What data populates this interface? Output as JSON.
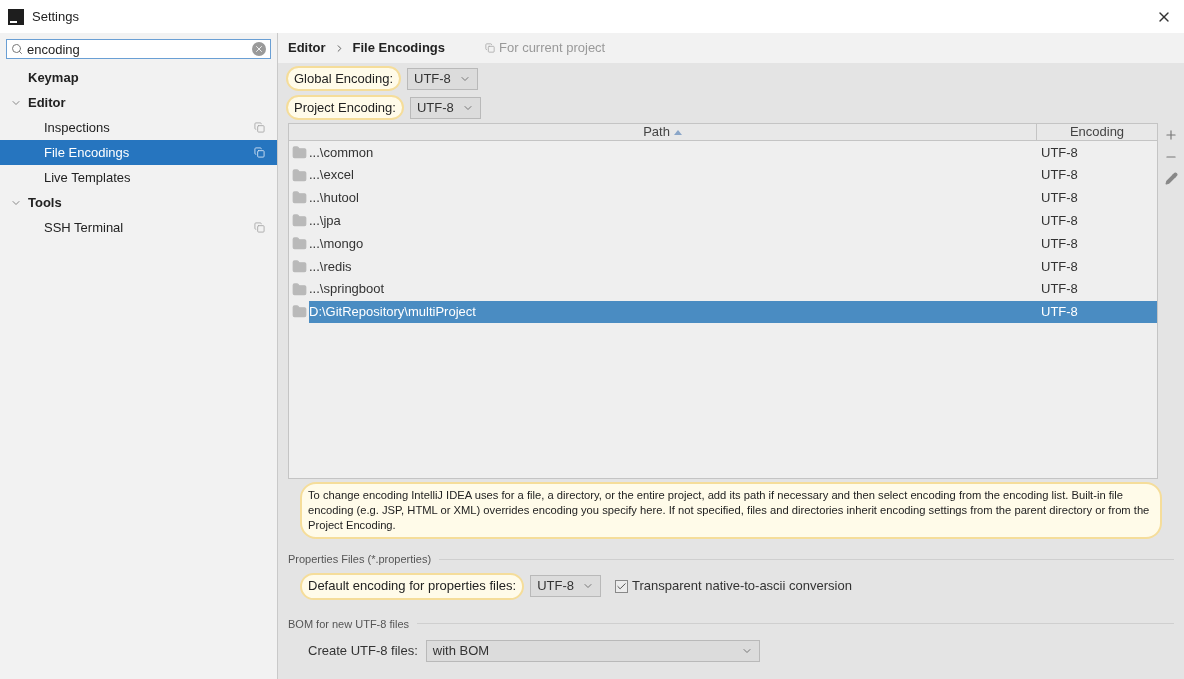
{
  "window": {
    "title": "Settings"
  },
  "search": {
    "value": "encoding"
  },
  "sidebar": {
    "items": [
      {
        "label": "Keymap",
        "selected": false
      },
      {
        "label": "Editor",
        "selected": false,
        "expanded": true,
        "children": [
          {
            "label": "Inspections",
            "selected": false,
            "project_scope": true
          },
          {
            "label": "File Encodings",
            "selected": true,
            "project_scope": true
          },
          {
            "label": "Live Templates",
            "selected": false,
            "project_scope": false
          }
        ]
      },
      {
        "label": "Tools",
        "selected": false,
        "expanded": true,
        "children": [
          {
            "label": "SSH Terminal",
            "selected": false,
            "project_scope": true
          }
        ]
      }
    ]
  },
  "breadcrumb": [
    "Editor",
    "File Encodings"
  ],
  "scope_note": "For current project",
  "encodings": [
    {
      "label": "Global Encoding:",
      "highlighted": true,
      "value": "UTF-8"
    },
    {
      "label": "Project Encoding:",
      "highlighted": true,
      "value": "UTF-8"
    }
  ],
  "table": {
    "columns": [
      {
        "label": "Path",
        "sorted": true
      },
      {
        "label": "Encoding"
      }
    ],
    "rows": [
      {
        "path": "...\\common",
        "encoding": "UTF-8",
        "selected": false
      },
      {
        "path": "...\\excel",
        "encoding": "UTF-8",
        "selected": false
      },
      {
        "path": "...\\hutool",
        "encoding": "UTF-8",
        "selected": false
      },
      {
        "path": "...\\jpa",
        "encoding": "UTF-8",
        "selected": false
      },
      {
        "path": "...\\mongo",
        "encoding": "UTF-8",
        "selected": false
      },
      {
        "path": "...\\redis",
        "encoding": "UTF-8",
        "selected": false
      },
      {
        "path": "...\\springboot",
        "encoding": "UTF-8",
        "selected": false
      },
      {
        "path": "D:\\GitRepository\\multiProject",
        "encoding": "UTF-8",
        "selected": true
      }
    ]
  },
  "hint": {
    "text": "To change encoding IntelliJ IDEA uses for a file, a directory, or the entire project, add its path if necessary and then select encoding from the encoding list. Built-in file encoding (e.g. JSP, HTML or XML) overrides encoding you specify here. If not specified, files and directories inherit encoding settings from the parent directory or from the Project Encoding.",
    "highlighted": true
  },
  "properties": {
    "title": "Properties Files (*.properties)",
    "label": "Default encoding for properties files:",
    "highlighted": true,
    "value": "UTF-8",
    "checkbox": {
      "label": "Transparent native-to-ascii conversion",
      "checked": true
    }
  },
  "bom": {
    "title": "BOM for new UTF-8 files",
    "label": "Create UTF-8 files:",
    "value": "with BOM"
  }
}
